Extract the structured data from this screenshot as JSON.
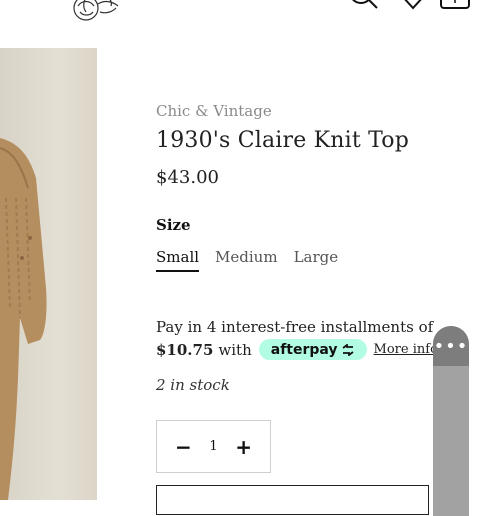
{
  "header": {
    "logo_icon": "rose-sketch-logo",
    "search_icon": "search-icon",
    "wishlist_icon": "heart-icon",
    "cart_icon": "shopping-bag-icon"
  },
  "product": {
    "vendor": "Chic & Vintage",
    "title": "1930's Claire Knit Top",
    "price": "$43.00",
    "size_label": "Size",
    "sizes": [
      "Small",
      "Medium",
      "Large"
    ],
    "selected_size": "Small",
    "installments_line1": "Pay in 4 interest-free installments of",
    "installment_amount": "$10.75",
    "installment_with": "with",
    "afterpay_label": "afterpay",
    "more_info": "More info",
    "stock": "2 in stock",
    "quantity": "1",
    "minus": "−",
    "plus": "+"
  },
  "widget": {
    "menu_label": "•••"
  },
  "colors": {
    "afterpay_mint": "#b2fce4",
    "text_dark": "#1a1a1a",
    "vendor_gray": "#8a8a8a"
  }
}
